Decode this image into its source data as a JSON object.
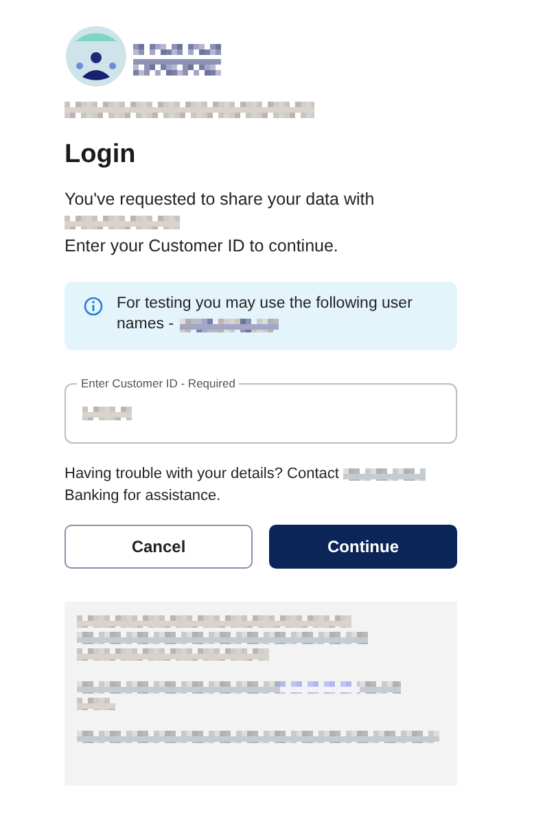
{
  "title": "Login",
  "intro": [
    "You've requested to share your data with",
    "Enter your Customer ID to continue."
  ],
  "info": {
    "lines": [
      "For testing you may use the following user",
      "names -"
    ]
  },
  "customer_id": {
    "label": "Enter Customer ID - Required"
  },
  "help": {
    "before": "Having trouble with your details? Contact",
    "after": "Banking for assistance."
  },
  "buttons": [
    {
      "label": "Cancel",
      "kind": "secondary"
    },
    {
      "label": "Continue",
      "kind": "primary"
    }
  ]
}
